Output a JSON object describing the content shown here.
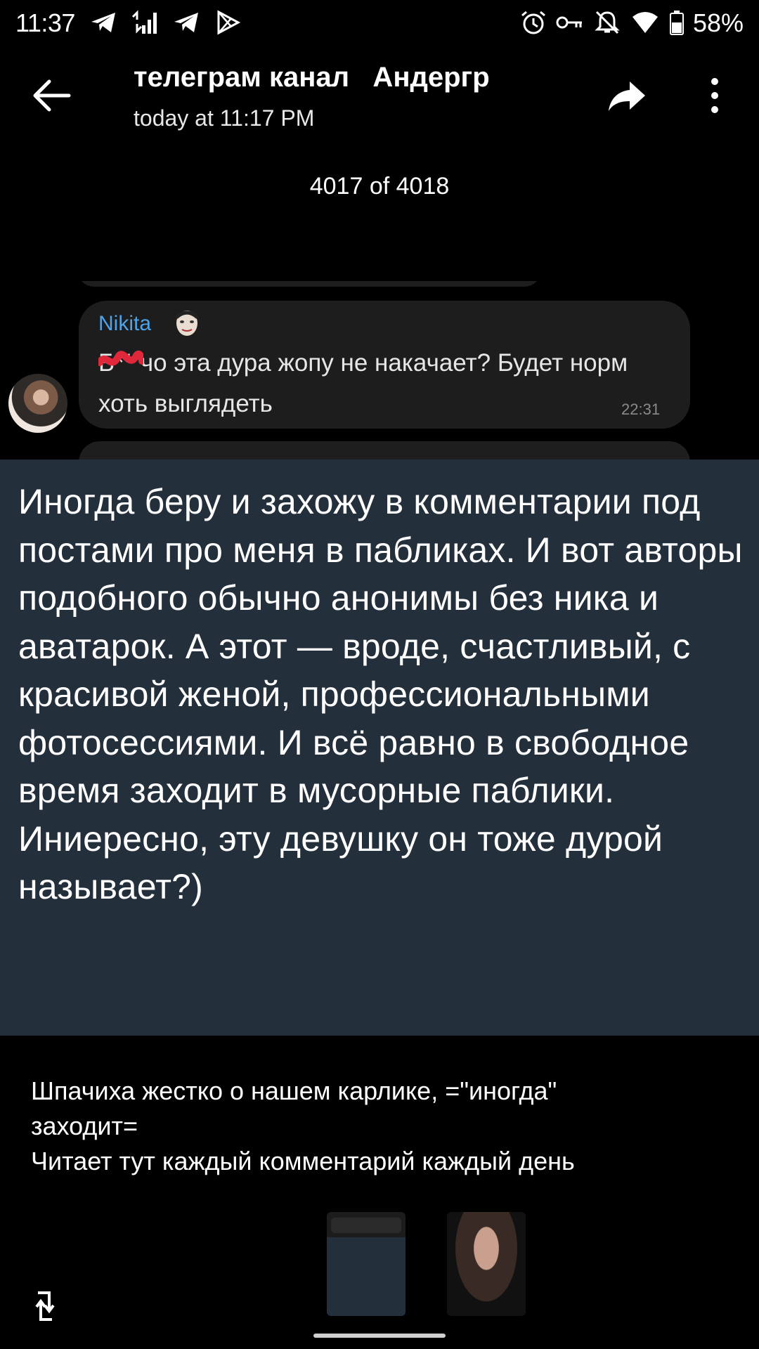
{
  "status_bar": {
    "time": "11:37",
    "battery_percent": "58%",
    "icons": [
      "telegram-icon",
      "signal-icon",
      "telegram-icon",
      "play-store-icon",
      "alarm-icon",
      "vpn-key-icon",
      "notifications-off-icon",
      "wifi-icon",
      "battery-icon"
    ]
  },
  "header": {
    "title": "телеграм канал   Андергр",
    "subtitle": "today at 11:17 PM",
    "counter": "4017 of 4018"
  },
  "message": {
    "author": "Nikita",
    "text": "Б** чо эта дура жопу не накачает? Будет норм хоть выглядеть",
    "time": "22:31"
  },
  "comment": {
    "text": "Иногда беру и захожу в комментарии под постами про меня в пабликах. И вот авторы подобного обычно анонимы без ника и аватарок. А этот — вроде, счастливый, с красивой женой, профессиональными фотосессиями. И всё равно в свободное время заходит в мусорные паблики. Иниересно, эту девушку он тоже дурой называет?)"
  },
  "caption": {
    "line1": "Шпачиха жестко о нашем карлике, =\"иногда\"",
    "line2": "заходит=",
    "line3": "Читает тут каждый комментарий каждый день"
  },
  "colors": {
    "background": "#000000",
    "comment_panel": "#232f3b",
    "bubble": "#1d1d1d",
    "author_name": "#4fa3e8"
  }
}
